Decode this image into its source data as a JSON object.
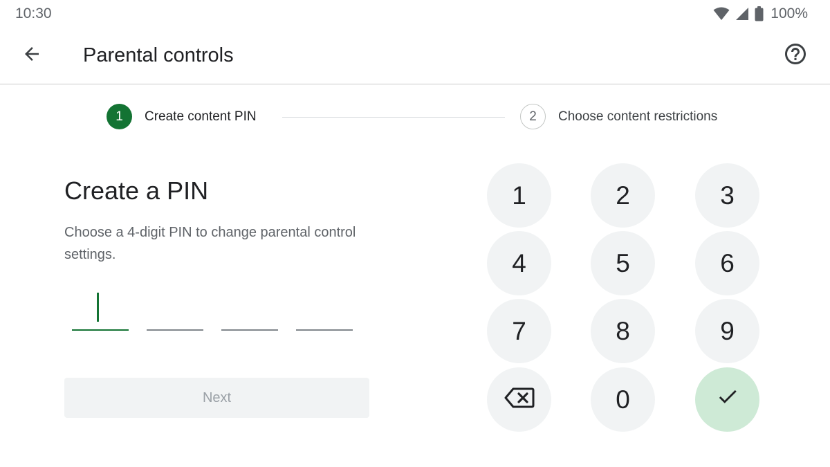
{
  "status_bar": {
    "time": "10:30",
    "battery": "100%",
    "icons": [
      "wifi-icon",
      "signal-icon",
      "battery-icon"
    ]
  },
  "app_bar": {
    "title": "Parental controls",
    "back_icon": "arrow-back-icon",
    "help_icon": "help-circle-icon"
  },
  "stepper": {
    "steps": [
      {
        "number": "1",
        "label": "Create content PIN",
        "state": "active"
      },
      {
        "number": "2",
        "label": "Choose content restrictions",
        "state": "inactive"
      }
    ]
  },
  "pin_form": {
    "title": "Create a PIN",
    "description": "Choose a 4-digit PIN to change parental control settings.",
    "digits": [
      "",
      "",
      "",
      ""
    ],
    "focused_index": 0,
    "next_label": "Next",
    "next_enabled": false
  },
  "keypad": {
    "keys": [
      "1",
      "2",
      "3",
      "4",
      "5",
      "6",
      "7",
      "8",
      "9",
      "",
      "0",
      ""
    ],
    "backspace_icon": "backspace-icon",
    "confirm_icon": "check-icon"
  },
  "colors": {
    "accent": "#137333",
    "confirm_bg": "#ceead6",
    "key_bg": "#f1f3f4",
    "disabled_text": "#9aa0a6"
  }
}
